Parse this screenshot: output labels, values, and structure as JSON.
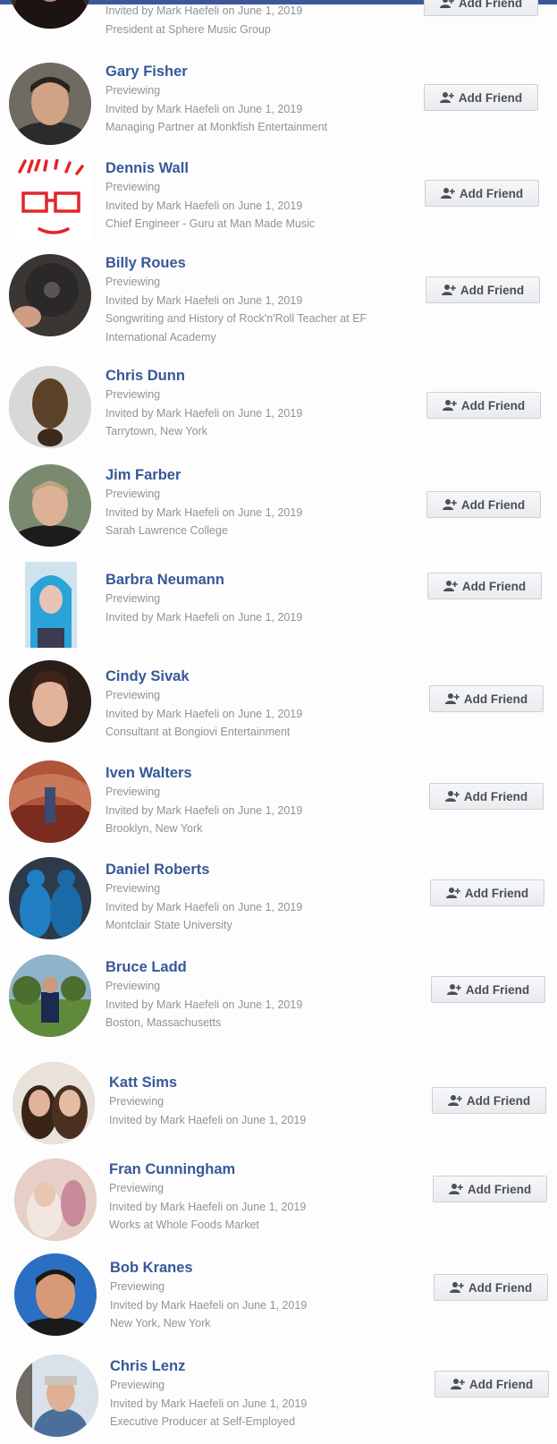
{
  "colors": {
    "name": "#365899",
    "meta": "#8d949e",
    "button_text": "#4b4f56",
    "brand": "#3b5998"
  },
  "button_icon": "add-friend-icon",
  "people": [
    {
      "name": "",
      "status": "",
      "invite": "Invited by Mark Haefeli on June 1, 2019",
      "detail": "President at Sphere Music Group",
      "button": "Add Friend"
    },
    {
      "name": "Gary Fisher",
      "status": "Previewing",
      "invite": "Invited by Mark Haefeli on June 1, 2019",
      "detail": "Managing Partner at Monkfish Entertainment",
      "button": "Add Friend"
    },
    {
      "name": "Dennis Wall",
      "status": "Previewing",
      "invite": "Invited by Mark Haefeli on June 1, 2019",
      "detail": "Chief Engineer - Guru at Man Made Music",
      "button": "Add Friend"
    },
    {
      "name": "Billy Roues",
      "status": "Previewing",
      "invite": "Invited by Mark Haefeli on June 1, 2019",
      "detail": "Songwriting and History of Rock'n'Roll Teacher at EF International Academy",
      "button": "Add Friend"
    },
    {
      "name": "Chris Dunn",
      "status": "Previewing",
      "invite": "Invited by Mark Haefeli on June 1, 2019",
      "detail": "Tarrytown, New York",
      "button": "Add Friend"
    },
    {
      "name": "Jim Farber",
      "status": "Previewing",
      "invite": "Invited by Mark Haefeli on June 1, 2019",
      "detail": "Sarah Lawrence College",
      "button": "Add Friend"
    },
    {
      "name": "Barbra Neumann",
      "status": "Previewing",
      "invite": "Invited by Mark Haefeli on June 1, 2019",
      "detail": "",
      "button": "Add Friend"
    },
    {
      "name": "Cindy Sivak",
      "status": "Previewing",
      "invite": "Invited by Mark Haefeli on June 1, 2019",
      "detail": "Consultant at Bongiovi Entertainment",
      "button": "Add Friend"
    },
    {
      "name": "Iven Walters",
      "status": "Previewing",
      "invite": "Invited by Mark Haefeli on June 1, 2019",
      "detail": "Brooklyn, New York",
      "button": "Add Friend"
    },
    {
      "name": "Daniel Roberts",
      "status": "Previewing",
      "invite": "Invited by Mark Haefeli on June 1, 2019",
      "detail": "Montclair State University",
      "button": "Add Friend"
    },
    {
      "name": "Bruce Ladd",
      "status": "Previewing",
      "invite": "Invited by Mark Haefeli on June 1, 2019",
      "detail": "Boston, Massachusetts",
      "button": "Add Friend"
    },
    {
      "name": "Katt Sims",
      "status": "Previewing",
      "invite": "Invited by Mark Haefeli on June 1, 2019",
      "detail": "",
      "button": "Add Friend"
    },
    {
      "name": "Fran Cunningham",
      "status": "Previewing",
      "invite": "Invited by Mark Haefeli on June 1, 2019",
      "detail": "Works at Whole Foods Market",
      "button": "Add Friend"
    },
    {
      "name": "Bob Kranes",
      "status": "Previewing",
      "invite": "Invited by Mark Haefeli on June 1, 2019",
      "detail": "New York, New York",
      "button": "Add Friend"
    },
    {
      "name": "Chris Lenz",
      "status": "Previewing",
      "invite": "Invited by Mark Haefeli on June 1, 2019",
      "detail": "Executive Producer at Self-Employed",
      "button": "Add Friend"
    }
  ]
}
